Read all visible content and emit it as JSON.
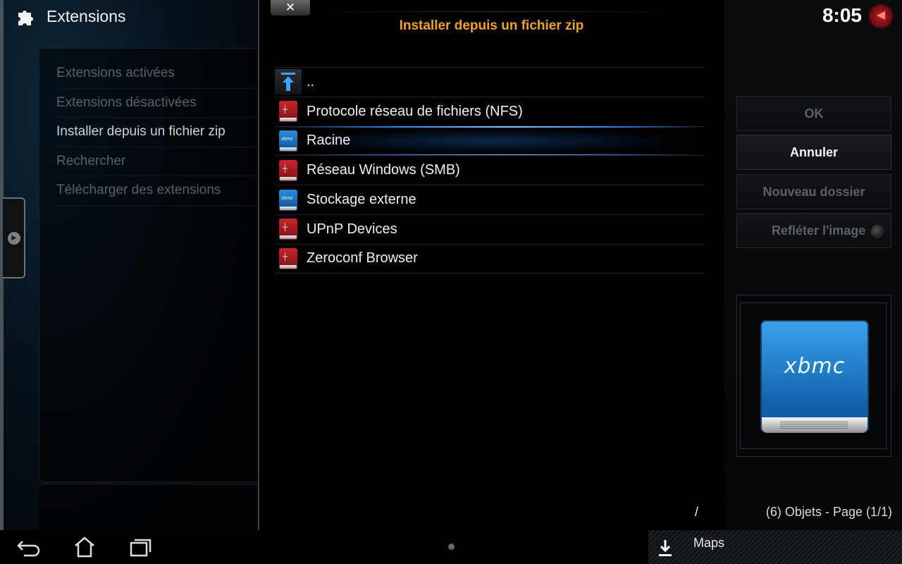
{
  "header": {
    "title": "Extensions",
    "icon": "puzzle-icon"
  },
  "sidebar": {
    "items": [
      {
        "label": "Extensions activées",
        "active": false
      },
      {
        "label": "Extensions désactivées",
        "active": false
      },
      {
        "label": "Installer depuis un fichier zip",
        "active": true
      },
      {
        "label": "Rechercher",
        "active": false
      },
      {
        "label": "Télécharger des extensions",
        "active": false
      }
    ]
  },
  "dialog": {
    "close_label": "✕",
    "title": "Installer depuis un fichier zip",
    "items": [
      {
        "label": "..",
        "icon": "parent-folder-icon"
      },
      {
        "label": "Protocole réseau de fichiers (NFS)",
        "icon": "network-drive-icon"
      },
      {
        "label": "Racine",
        "icon": "local-drive-icon",
        "selected": true
      },
      {
        "label": "Réseau Windows (SMB)",
        "icon": "network-drive-icon"
      },
      {
        "label": "Stockage externe",
        "icon": "local-drive-icon"
      },
      {
        "label": "UPnP Devices",
        "icon": "network-drive-icon"
      },
      {
        "label": "Zeroconf Browser",
        "icon": "network-drive-icon"
      }
    ],
    "current_path": "/",
    "item_count": "(6) Objets - Page (1/1)"
  },
  "right_panel": {
    "clock": "8:05",
    "buttons": {
      "ok": "OK",
      "cancel": "Annuler",
      "new_folder": "Nouveau dossier",
      "mirror_image": "Refléter l'image"
    },
    "thumbnail_logo": "xbmc"
  },
  "navbar": {
    "notification_label": "Maps"
  },
  "colors": {
    "title_accent": "#f0a02e",
    "selection_glow": "#2f7ad6",
    "network_drive": "#c7262b",
    "local_drive": "#2d8ee0"
  }
}
